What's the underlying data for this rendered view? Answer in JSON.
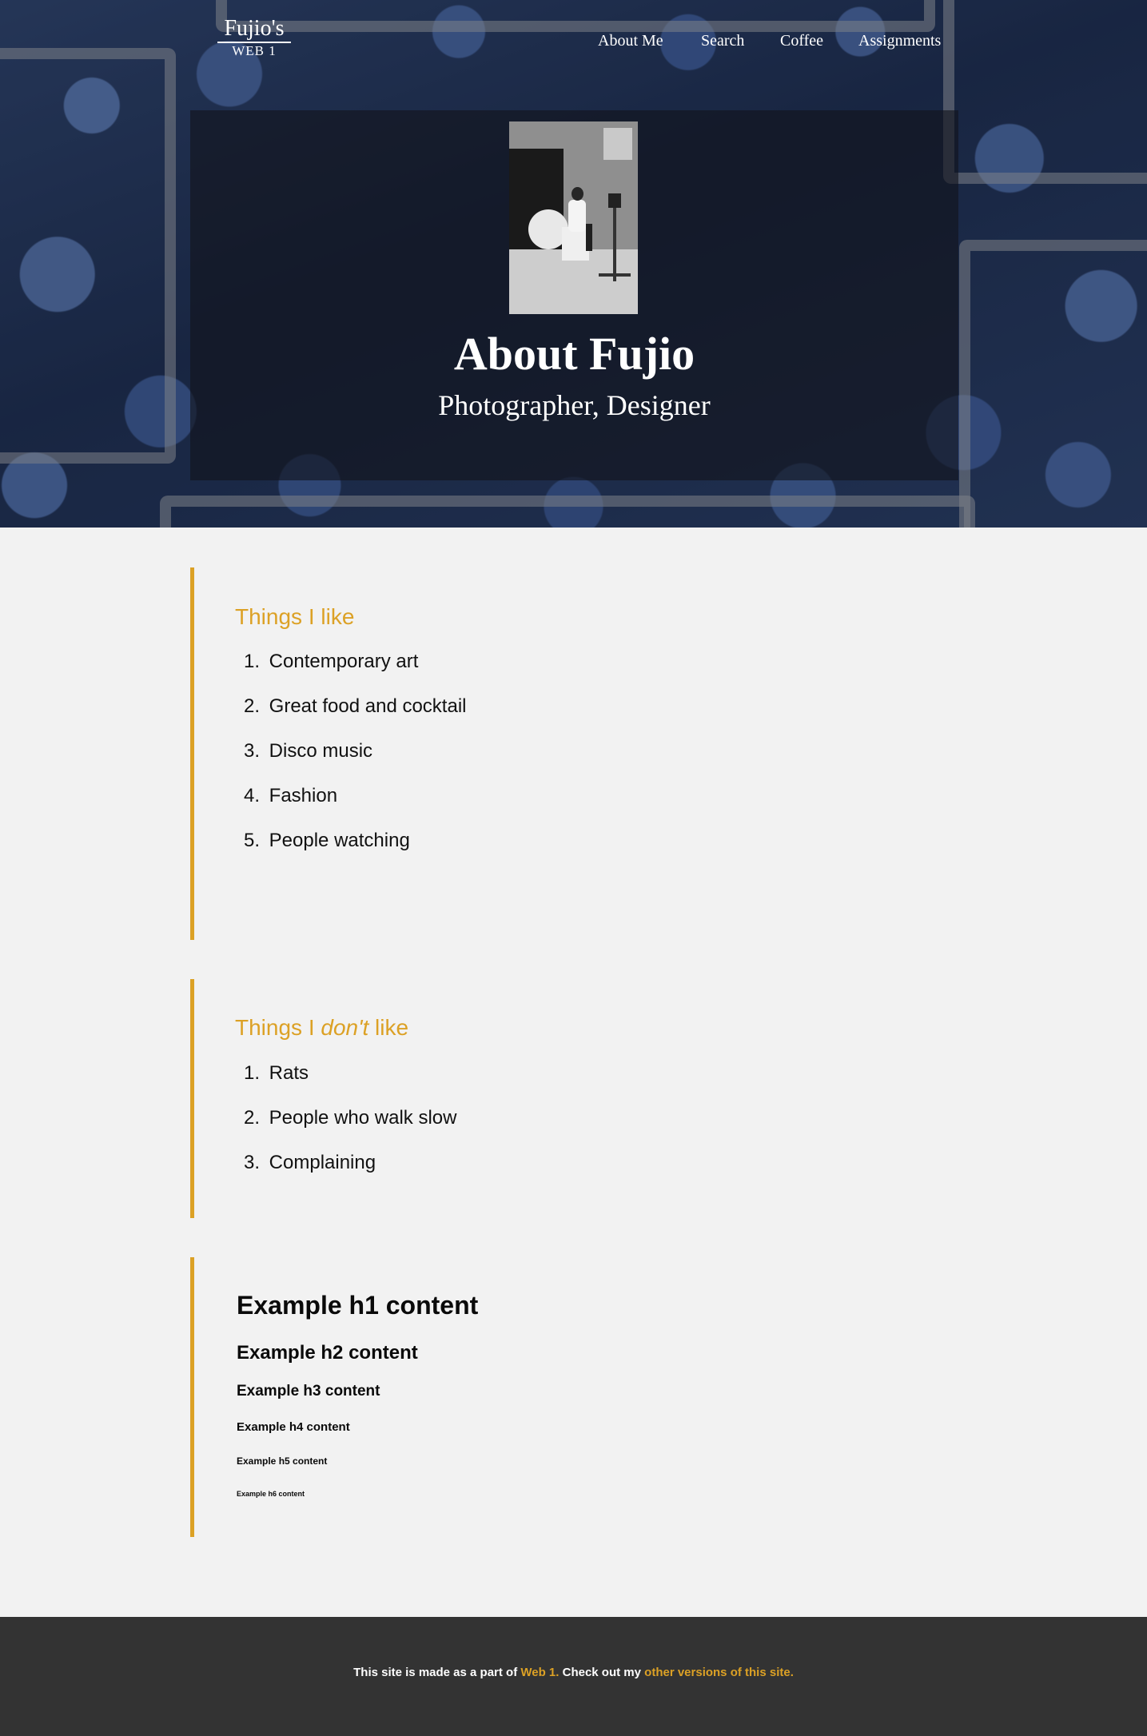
{
  "header": {
    "logo_top": "Fujio's",
    "logo_bottom": "WEB 1",
    "nav": [
      "About Me",
      "Search",
      "Coffee",
      "Assignments"
    ]
  },
  "hero": {
    "title": "About Fujio",
    "subtitle": "Photographer, Designer"
  },
  "likes": {
    "heading": "Things I like",
    "items": [
      "Contemporary art",
      "Great food and cocktail",
      "Disco music",
      "Fashion",
      "People watching"
    ]
  },
  "dislikes": {
    "heading_before": "Things I ",
    "heading_em": "don't",
    "heading_after": " like",
    "items": [
      "Rats",
      "People who walk slow",
      "Complaining"
    ]
  },
  "examples": {
    "h1": "Example h1 content",
    "h2": "Example h2 content",
    "h3": "Example h3 content",
    "h4": "Example h4 content",
    "h5": "Example h5 content",
    "h6": "Example h6 content"
  },
  "footer": {
    "text_1": "This site is made as a part of ",
    "link_1": "Web 1.",
    "text_2": " Check out my ",
    "link_2": "other versions of this site."
  },
  "colors": {
    "accent": "#dca125",
    "footer_bg": "#333333",
    "page_bg": "#f2f2f2"
  }
}
